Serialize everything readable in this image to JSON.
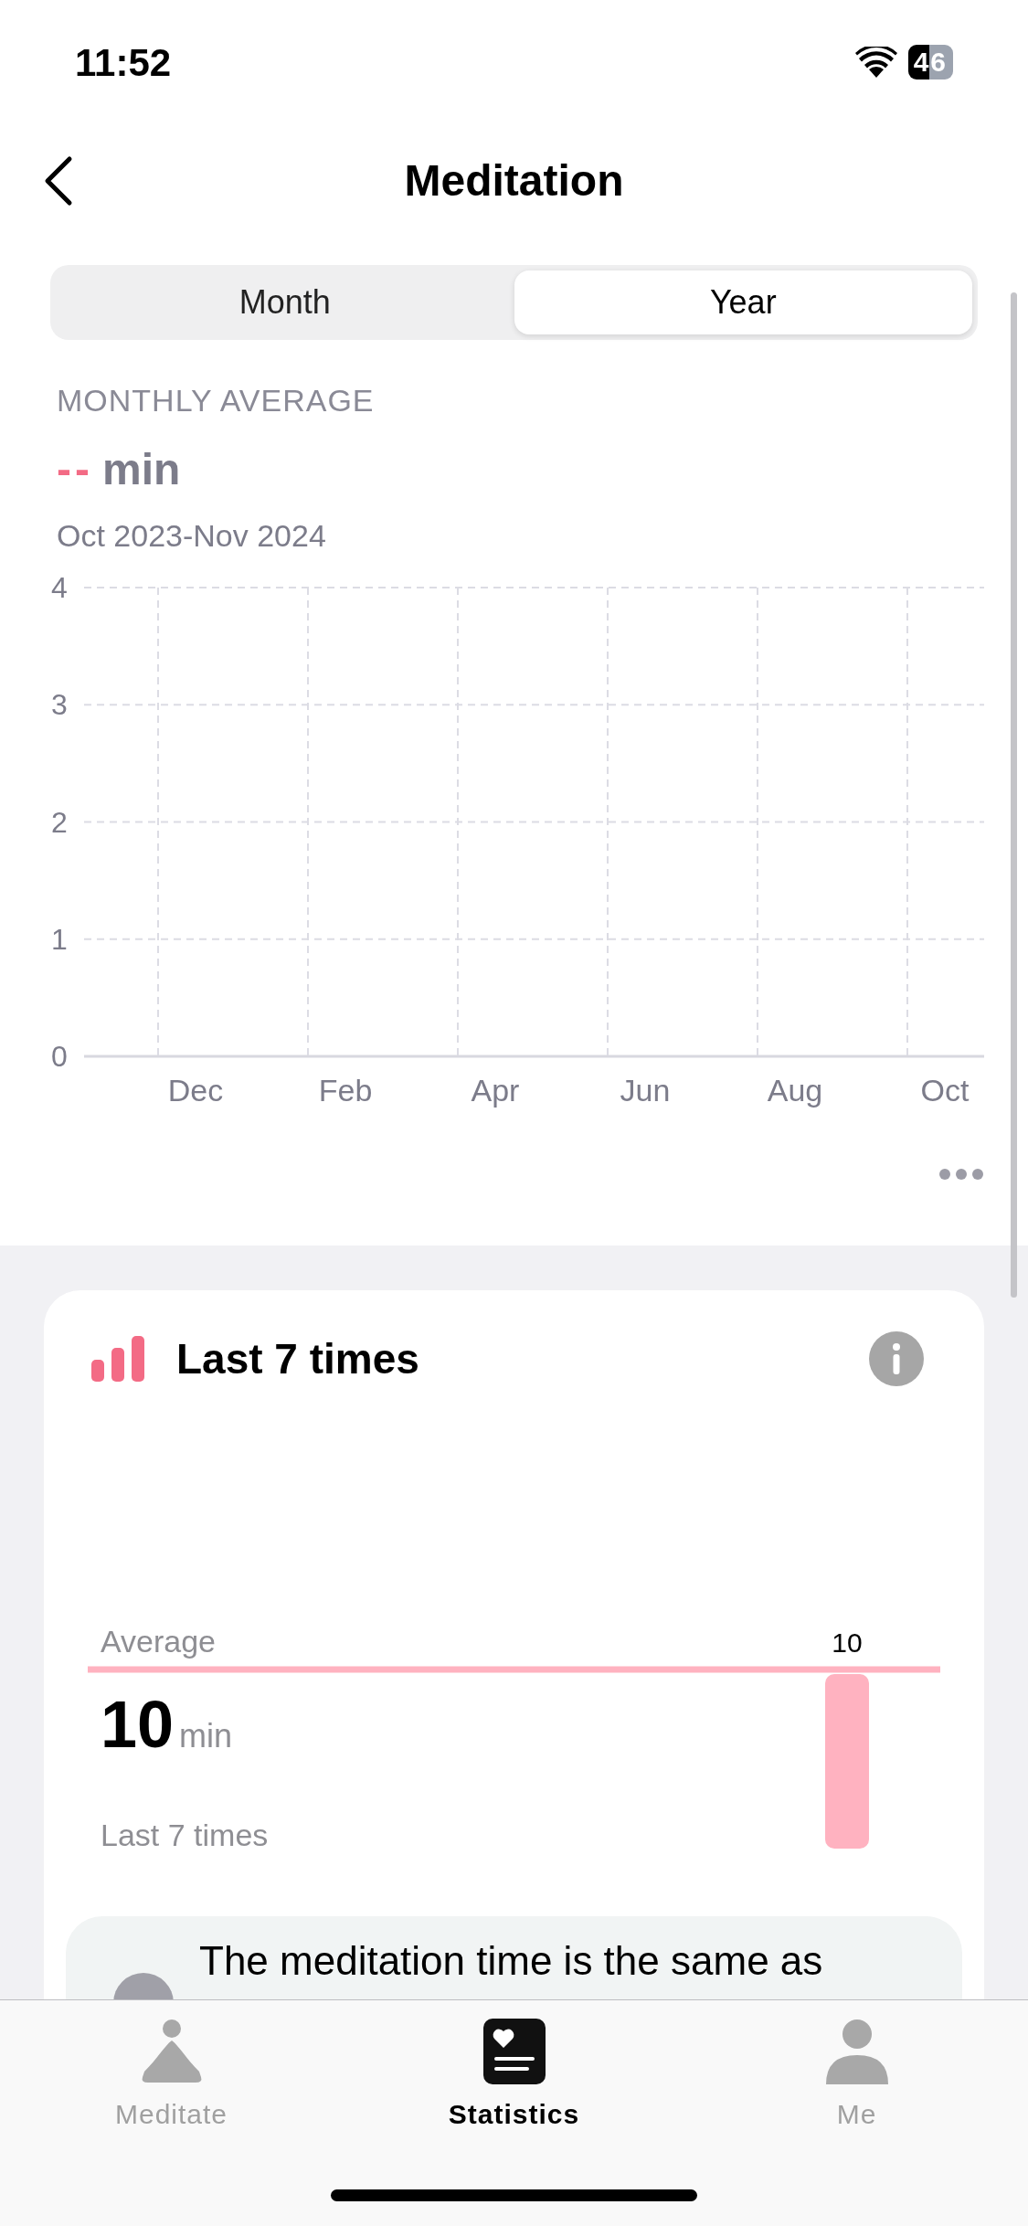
{
  "status_bar": {
    "time": "11:52",
    "battery": "46"
  },
  "header": {
    "title": "Meditation"
  },
  "tabs": [
    {
      "label": "Month",
      "selected": false
    },
    {
      "label": "Year",
      "selected": true
    }
  ],
  "summary": {
    "label": "MONTHLY AVERAGE",
    "value": "--",
    "unit": "min",
    "range": "Oct 2023-Nov 2024"
  },
  "chart_data": {
    "type": "line",
    "categories": [
      "Dec",
      "Feb",
      "Apr",
      "Jun",
      "Aug",
      "Oct"
    ],
    "ylim": [
      0,
      4
    ],
    "yticks": [
      0,
      1,
      2,
      3,
      4
    ],
    "grid": true
  },
  "last_times_card": {
    "title": "Last 7 times",
    "average_label": "Average",
    "average_value": "10",
    "average_unit": "min",
    "caption": "Last 7 times",
    "bar_label": "10"
  },
  "insight": {
    "text": "The meditation time is the same as"
  },
  "tab_bar": [
    {
      "label": "Meditate",
      "kind": "meditate",
      "selected": false
    },
    {
      "label": "Statistics",
      "kind": "statistics",
      "selected": true
    },
    {
      "label": "Me",
      "kind": "me",
      "selected": false
    }
  ]
}
